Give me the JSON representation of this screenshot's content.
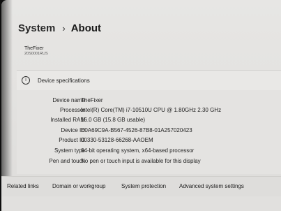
{
  "breadcrumb": {
    "parent": "System",
    "separator": "›",
    "current": "About"
  },
  "device": {
    "name": "TheFixer",
    "model": "20S0001RUS"
  },
  "device_specs": {
    "title": "Device specifications",
    "icon": "info-icon",
    "rows": [
      {
        "label": "Device name",
        "value": "TheFixer"
      },
      {
        "label": "Processor",
        "value": "Intel(R) Core(TM) i7-10510U CPU @ 1.80GHz   2.30 GHz"
      },
      {
        "label": "Installed RAM",
        "value": "16.0 GB (15.8 GB usable)"
      },
      {
        "label": "Device ID",
        "value": "E0A69C9A-B567-4526-87B8-01A257020423"
      },
      {
        "label": "Product ID",
        "value": "00330-53128-66268-AAOEM"
      },
      {
        "label": "System type",
        "value": "64-bit operating system, x64-based processor"
      },
      {
        "label": "Pen and touch",
        "value": "No pen or touch input is available for this display"
      }
    ]
  },
  "related": {
    "label": "Related links",
    "links": [
      "Domain or workgroup",
      "System protection",
      "Advanced system settings"
    ]
  }
}
